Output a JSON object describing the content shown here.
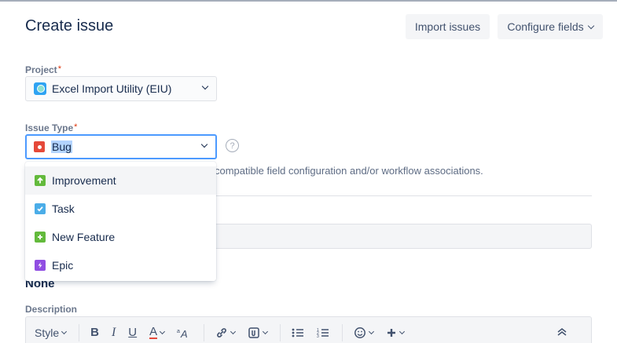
{
  "header": {
    "title": "Create issue",
    "import_label": "Import issues",
    "configure_label": "Configure fields"
  },
  "project": {
    "label": "Project",
    "required_mark": "*",
    "value": "Excel Import Utility (EIU)"
  },
  "issue_type": {
    "label": "Issue Type",
    "required_mark": "*",
    "value": "Bug",
    "help_glyph": "?",
    "note": "compatible field configuration and/or workflow associations.",
    "options": [
      {
        "label": "Improvement",
        "icon": "improvement-icon",
        "highlighted": true
      },
      {
        "label": "Task",
        "icon": "task-icon",
        "highlighted": false
      },
      {
        "label": "New Feature",
        "icon": "new-feature-icon",
        "highlighted": false
      },
      {
        "label": "Epic",
        "icon": "epic-icon",
        "highlighted": false
      }
    ]
  },
  "none_text": "None",
  "description": {
    "label": "Description",
    "toolbar": {
      "style_label": "Style",
      "bold": "B",
      "italic": "I",
      "underline": "U",
      "text_color": "A"
    }
  },
  "colors": {
    "focus_border": "#4c9aff",
    "required": "#de350b",
    "bug": "#e5493a",
    "improvement": "#63ba3c",
    "task": "#4bade8",
    "epic": "#904ee2"
  }
}
